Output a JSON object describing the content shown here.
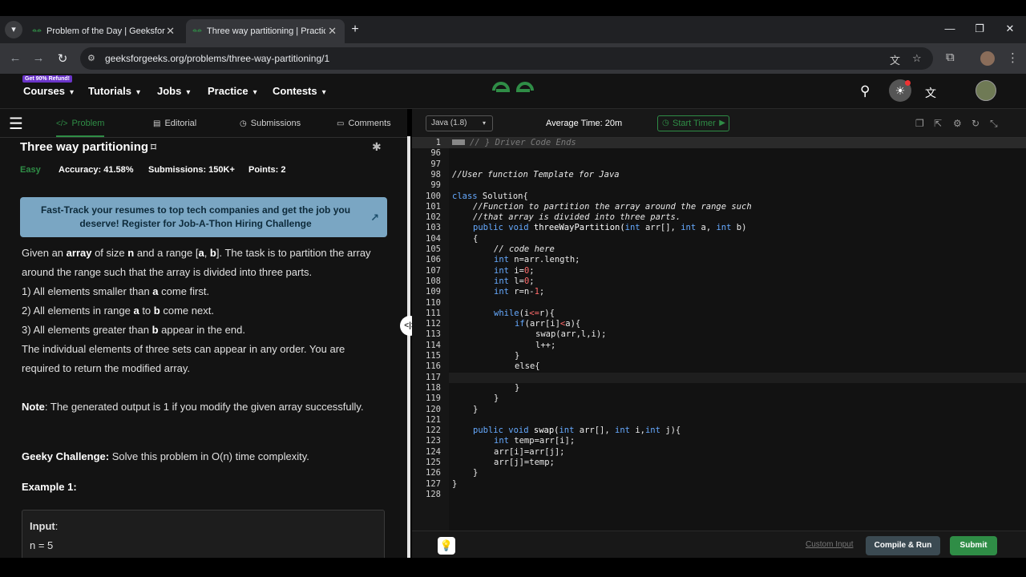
{
  "browser": {
    "tabs": [
      {
        "label": "Problem of the Day | GeeksforGeeks",
        "active": false
      },
      {
        "label": "Three way partitioning | Practice",
        "active": true
      }
    ],
    "url": "geeksforgeeks.org/problems/three-way-partitioning/1",
    "icons": {
      "tab_menu": "▾",
      "close": "✕",
      "new_tab": "+",
      "minimize": "—",
      "maximize": "❐",
      "close_window": "✕",
      "back": "←",
      "forward": "→",
      "reload": "↻",
      "site_info": "⚙",
      "translate": "文",
      "star": "☆",
      "extensions": "⧉",
      "menu": "⋮"
    }
  },
  "header": {
    "badge": "Get 90% Refund!",
    "nav": [
      "Courses",
      "Tutorials",
      "Jobs",
      "Practice",
      "Contests"
    ],
    "chevron": "▾",
    "search_icon": "⚲",
    "theme_icon": "☀",
    "translate_icon": "文"
  },
  "left": {
    "tabs": [
      {
        "icon": "</>",
        "label": "Problem"
      },
      {
        "icon": "▤",
        "label": "Editorial"
      },
      {
        "icon": "◷",
        "label": "Submissions"
      },
      {
        "icon": "▭",
        "label": "Comments"
      }
    ],
    "hamburger_icon": "☰",
    "title": "Three way partitioning",
    "bookmark_icon": "⌑",
    "bug_icon": "✱",
    "difficulty": "Easy",
    "accuracy": "Accuracy: 41.58%",
    "submissions": "Submissions: 150K+",
    "points": "Points: 2",
    "banner": "Fast-Track your resumes to top tech companies and get the job you deserve! Register for Job-A-Thon Hiring Challenge",
    "banner_icon": "↗",
    "desc": {
      "p1_a": "Given an ",
      "p1_b": "array",
      "p1_c": " of size ",
      "p1_d": "n",
      "p1_e": " and a range [",
      "p1_f": "a",
      "p1_g": ", ",
      "p1_h": "b",
      "p1_i": "]. The task is to partition the array around the range such that the array is divided into three parts.",
      "l1_a": "1) All elements smaller than ",
      "l1_b": "a",
      "l1_c": " come first.",
      "l2_a": "2) All elements in range ",
      "l2_b": "a",
      "l2_c": " to ",
      "l2_d": "b",
      "l2_e": " come next.",
      "l3_a": "3) All elements greater than ",
      "l3_b": "b",
      "l3_c": " appear in the end.",
      "p2": "The individual elements of three sets can appear in any order. You are required to return the modified array.",
      "note_label": "Note",
      "note_text": ": The generated output is 1 if you modify the given array successfully.",
      "geeky_label": "Geeky Challenge:",
      "geeky_text": " Solve this problem in O(n) time complexity."
    },
    "example_title": "Example 1:",
    "example_input_label": "Input",
    "example_input_colon": ":",
    "example_input_value": "n = 5",
    "divider_icon": "<|>"
  },
  "right": {
    "language": "Java (1.8)",
    "language_caret": "▾",
    "avg_time": "Average Time: 20m",
    "timer_label": "Start Timer",
    "timer_icon": "◷",
    "timer_play_icon": "▶",
    "toolbar_icons": [
      "❐",
      "⇱",
      "⚙",
      "↻",
      "⤡"
    ],
    "bulb_icon": "💡",
    "custom_input": "Custom Input",
    "compile_label": "Compile & Run",
    "submit_label": "Submit",
    "code": {
      "fold_comment": "// } Driver Code Ends",
      "l98": "//User function Template for Java",
      "l100_kw": "class",
      "l100_rest": " Solution{",
      "l101": "//Function to partition the array around the range such",
      "l102": "//that array is divided into three parts.",
      "l103_kw1": "public void",
      "l103_fn": " threeWayPartition(",
      "l103_kw2": "int",
      "l103_a": " arr[], ",
      "l103_kw3": "int",
      "l103_b": " a, ",
      "l103_kw4": "int",
      "l103_c": " b)",
      "l104": "{",
      "l105": "// code here",
      "l106_kw": "int",
      "l106_rest": " n=arr.length;",
      "l107_kw": "int",
      "l107_a": " i=",
      "l107_n": "0",
      "l107_b": ";",
      "l108_kw": "int",
      "l108_a": " l=",
      "l108_n": "0",
      "l108_b": ";",
      "l109_kw": "int",
      "l109_a": " r=n-",
      "l109_n": "1",
      "l109_b": ";",
      "l111_kw": "while",
      "l111_a": "(i",
      "l111_op": "<=",
      "l111_b": "r){",
      "l112_kw": "if",
      "l112_a": "(arr[i]",
      "l112_op": "<",
      "l112_b": "a){",
      "l113": "swap(arr,l,i);",
      "l114": "l++;",
      "l115": "}",
      "l116": "else{",
      "l118": "}",
      "l119": "}",
      "l120": "}",
      "l122_kw1": "public void",
      "l122_fn": " swap(",
      "l122_kw2": "int",
      "l122_a": " arr[], ",
      "l122_kw3": "int",
      "l122_b": " i,",
      "l122_kw4": "int",
      "l122_c": " j){",
      "l123_kw": "int",
      "l123_rest": " temp=arr[i];",
      "l124": "arr[i]=arr[j];",
      "l125": "arr[j]=temp;",
      "l126": "}",
      "l127": "}"
    },
    "line_numbers": [
      "1",
      "96",
      "97",
      "98",
      "99",
      "100",
      "101",
      "102",
      "103",
      "104",
      "105",
      "106",
      "107",
      "108",
      "109",
      "110",
      "111",
      "112",
      "113",
      "114",
      "115",
      "116",
      "117",
      "118",
      "119",
      "120",
      "121",
      "122",
      "123",
      "124",
      "125",
      "126",
      "127",
      "128"
    ]
  }
}
